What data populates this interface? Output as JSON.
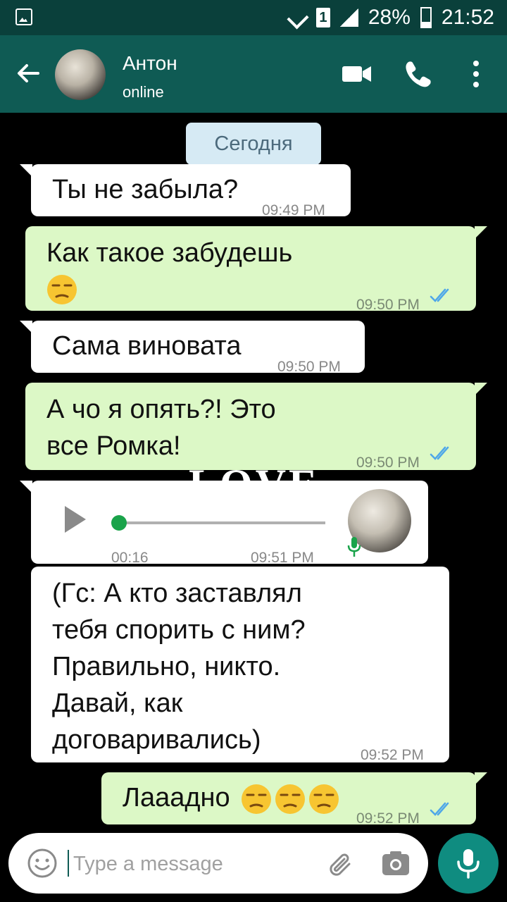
{
  "status_bar": {
    "battery": "28%",
    "time": "21:52",
    "sim_label": "1"
  },
  "header": {
    "contact_name": "Антон",
    "contact_status": "online"
  },
  "chat": {
    "date_chip": "Сегодня",
    "background_text": "LOVE",
    "messages": [
      {
        "direction": "in",
        "text": "Ты не забыла?",
        "time": "09:49 PM"
      },
      {
        "direction": "out",
        "text": "Как такое забудешь",
        "emoji": "unamused",
        "time": "09:50 PM",
        "status": "read"
      },
      {
        "direction": "in",
        "text": "Сама виновата",
        "time": "09:50 PM"
      },
      {
        "direction": "out",
        "line1": "А чо я опять?! Это",
        "line2": "все Ромка!",
        "time": "09:50 PM",
        "status": "read"
      },
      {
        "direction": "in",
        "type": "voice",
        "duration": "00:16",
        "time": "09:51 PM",
        "progress": 0
      },
      {
        "direction": "in",
        "lines": [
          "(Гс: А кто заставлял",
          "тебя спорить с ним?",
          "Правильно, никто.",
          "Давай, как",
          "договаривались)"
        ],
        "time": "09:52 PM"
      },
      {
        "direction": "out",
        "text": "Лааадно",
        "emoji": "unamused x3",
        "time": "09:52 PM",
        "status": "read"
      }
    ]
  },
  "input": {
    "placeholder": "Type a message"
  },
  "colors": {
    "header": "#0f5b54",
    "status_bar": "#0a403b",
    "outgoing": "#dcf8c6",
    "incoming": "#ffffff",
    "date_chip": "#d6eaf4",
    "read_ticks": "#4fa7e8",
    "fab": "#0f8c80"
  }
}
